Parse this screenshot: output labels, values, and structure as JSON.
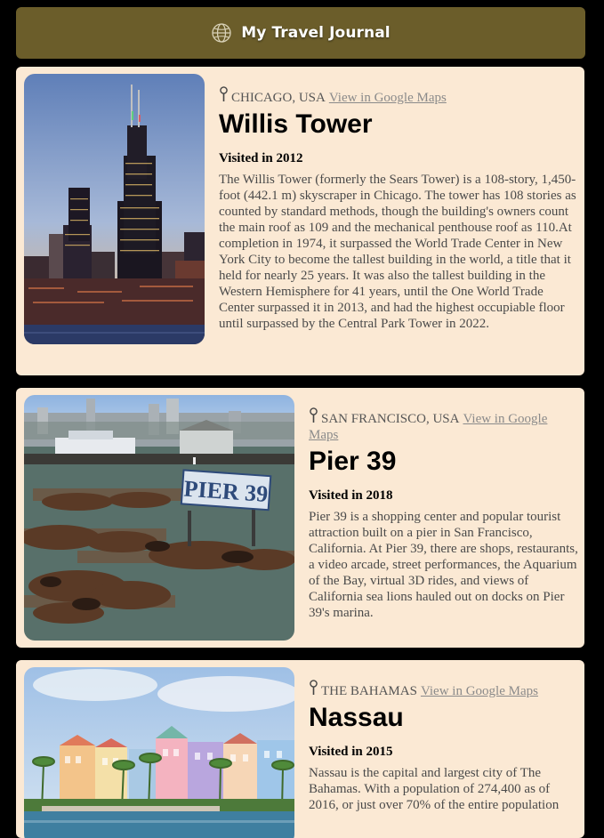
{
  "app": {
    "title": "My Travel Journal",
    "header_color": "#6b5d2a",
    "card_color": "#fbe9d4",
    "header_icon": "globe-icon"
  },
  "entries": [
    {
      "location": "Chicago, USA",
      "maps_label": "View in Google Maps",
      "title": "Willis Tower",
      "visited": "Visited in 2012",
      "description": "The Willis Tower (formerly the Sears Tower) is a 108-story, 1,450-foot (442.1 m) skyscraper in Chicago. The tower has 108 stories as counted by standard methods, though the building's owners count the main roof as 109 and the mechanical penthouse roof as 110.At completion in 1974, it surpassed the World Trade Center in New York City to become the tallest building in the world, a title that it held for nearly 25 years. It was also the tallest building in the Western Hemisphere for 41 years, until the One World Trade Center surpassed it in 2013, and had the highest occupiable floor until surpassed by the Central Park Tower in 2022."
    },
    {
      "location": "San Francisco, USA",
      "maps_label": "View in Google Maps",
      "title": "Pier 39",
      "visited": "Visited in 2018",
      "description": "Pier 39 is a shopping center and popular tourist attraction built on a pier in San Francisco, California. At Pier 39, there are shops, restaurants, a video arcade, street performances, the Aquarium of the Bay, virtual 3D rides, and views of California sea lions hauled out on docks on Pier 39's marina.",
      "sign_text": "PIER 39"
    },
    {
      "location": "The Bahamas",
      "maps_label": "View in Google Maps",
      "title": "Nassau",
      "visited": "Visited in 2015",
      "description": "Nassau is the capital and largest city of The Bahamas. With a population of 274,400 as of 2016, or just over 70% of the entire population"
    }
  ]
}
